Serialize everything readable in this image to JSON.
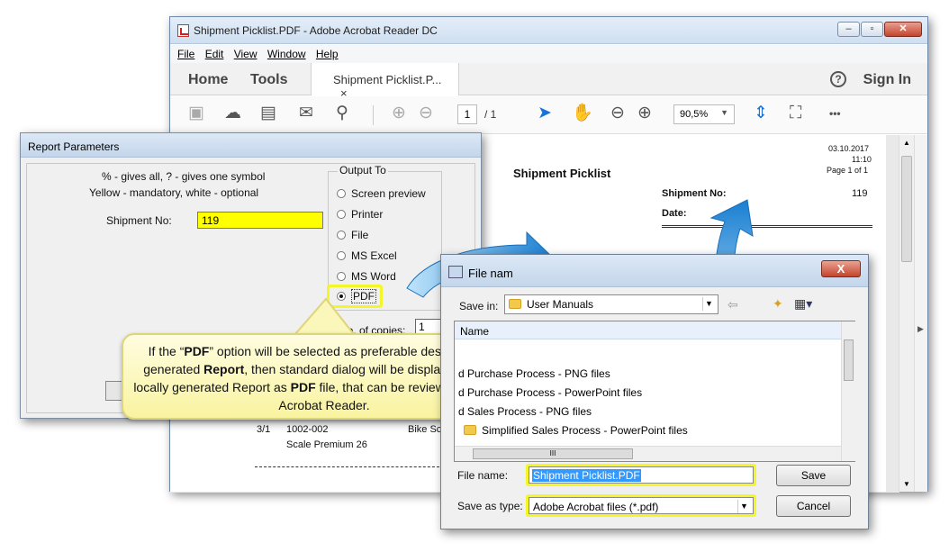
{
  "acrobat": {
    "title": "Shipment Picklist.PDF - Adobe Acrobat Reader DC",
    "menu": [
      "File",
      "Edit",
      "View",
      "Window",
      "Help"
    ],
    "tab_home": "Home",
    "tab_tools": "Tools",
    "doc_tab": "Shipment Picklist.P...",
    "doc_tab_close": "×",
    "help": "?",
    "sign_in": "Sign In",
    "page_current": "1",
    "page_total": "/ 1",
    "zoom": "90,5%",
    "more": "•••",
    "doc": {
      "date": "03.10.2017",
      "time": "11:10",
      "page": "Page 1 of 1",
      "heading": "Shipment Picklist",
      "shipment_label": "Shipment No:",
      "shipment_value": "119",
      "date_label": "Date:",
      "row_pos": "3/1",
      "row_code": "1002-002",
      "row_name": "Bike Sc",
      "row_desc": "Scale Premium 26"
    }
  },
  "report": {
    "title": "Report Parameters",
    "hint1": "% - gives all, ? - gives one symbol",
    "hint2": "Yellow - mandatory, white - optional",
    "shipment_label": "Shipment No:",
    "shipment_value": "119",
    "output_title": "Output To",
    "options": [
      "Screen preview",
      "Printer",
      "File",
      "MS Excel",
      "MS Word",
      "PDF"
    ],
    "selected": "PDF",
    "copies_label": "No. of copies:",
    "copies_value": "1"
  },
  "callout": {
    "part1": "If the “",
    "b1": "PDF",
    "part2": "” option will be selected as preferable destination for generated ",
    "b2": "Report",
    "part3": ", then standard dialog will be displayed to save locally generated Report as ",
    "b3": "PDF",
    "part4": " file, that can be reviewed by Adobe Acrobat Reader."
  },
  "save_dialog": {
    "title": "File nam",
    "close": "X",
    "save_in_label": "Save in:",
    "save_in_value": "User Manuals",
    "col_name": "Name",
    "files": [
      "d Purchase Process - PNG files",
      "d Purchase Process - PowerPoint files",
      "d Sales Process - PNG files",
      "Simplified Sales Process - PowerPoint files"
    ],
    "hscroll_grip": "III",
    "filename_label": "File name:",
    "filename_value": "Shipment Picklist.PDF",
    "type_label": "Save as type:",
    "type_value": "Adobe Acrobat files (*.pdf)",
    "save_btn": "Save",
    "cancel_btn": "Cancel"
  },
  "colors": {
    "highlight": "#f5f62a",
    "arrow": "#1e8fd8",
    "mandatory": "#ffff00"
  }
}
